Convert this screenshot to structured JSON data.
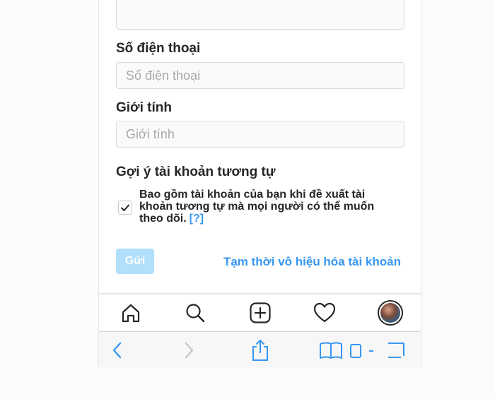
{
  "form": {
    "phone": {
      "label": "Số điện thoại",
      "placeholder": "Số điện thoại",
      "value": ""
    },
    "gender": {
      "label": "Giới tính",
      "placeholder": "Giới tính",
      "value": ""
    },
    "similar_accounts": {
      "title": "Gợi ý tài khoản tương tự",
      "checked": true,
      "text": "Bao gồm tài khoản của bạn khi đề xuất tài khoản tương tự mà mọi người có thể muốn theo dõi.",
      "help_link": "[?]"
    },
    "submit_label": "Gửi",
    "disable_link": "Tạm thời vô hiệu hóa tài khoản"
  },
  "colors": {
    "accent": "#3897f0",
    "submit_disabled": "#b2dffc",
    "text": "#262626",
    "border": "#dbdbdb"
  },
  "tabbar": {
    "icons": [
      "home-icon",
      "search-icon",
      "add-post-icon",
      "heart-icon",
      "profile-avatar"
    ]
  },
  "browser_toolbar": {
    "icons": [
      "back-icon",
      "forward-icon",
      "share-icon",
      "bookmarks-icon",
      "tabs-icon"
    ]
  }
}
